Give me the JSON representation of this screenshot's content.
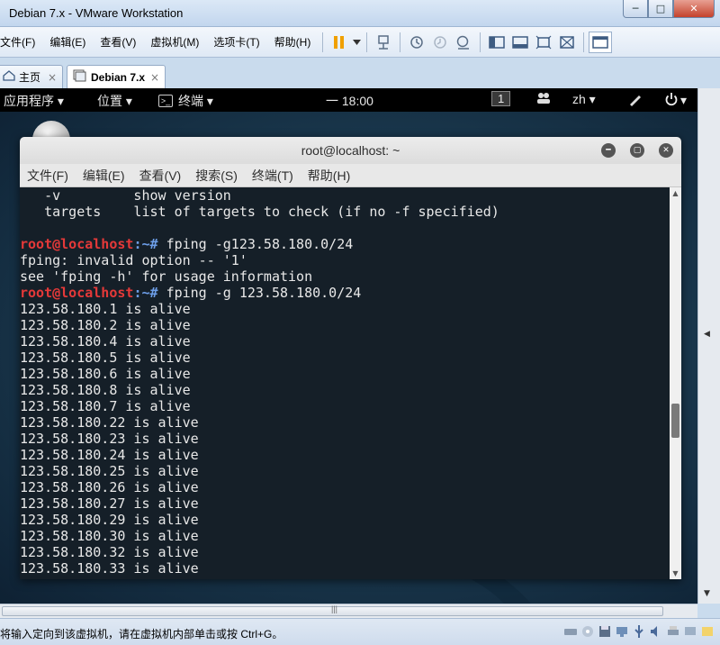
{
  "window": {
    "title": "Debian 7.x - VMware Workstation",
    "min": "─",
    "max": "□",
    "close": "✕"
  },
  "menu": [
    "文件(F)",
    "编辑(E)",
    "查看(V)",
    "虚拟机(M)",
    "选项卡(T)",
    "帮助(H)"
  ],
  "tabs": [
    {
      "label": "主页",
      "close": "×"
    },
    {
      "label": "Debian 7.x",
      "close": "×"
    }
  ],
  "gnome": {
    "apps": "应用程序 ▾",
    "places": "位置 ▾",
    "terminal": "终端 ▾",
    "clock": "一 18:00",
    "workspace": "1",
    "lang": "zh ▾",
    "power": "▾"
  },
  "terminal": {
    "title": "root@localhost: ~",
    "menu": [
      "文件(F)",
      "编辑(E)",
      "查看(V)",
      "搜索(S)",
      "终端(T)",
      "帮助(H)"
    ],
    "prompt_user": "root@localhost",
    "prompt_sep": ":~# ",
    "lines": [
      {
        "type": "text",
        "text": "   -v         show version"
      },
      {
        "type": "text",
        "text": "   targets    list of targets to check (if no -f specified)"
      },
      {
        "type": "text",
        "text": ""
      },
      {
        "type": "cmd",
        "cmd": "fping -g123.58.180.0/24"
      },
      {
        "type": "text",
        "text": "fping: invalid option -- '1'"
      },
      {
        "type": "text",
        "text": "see 'fping -h' for usage information"
      },
      {
        "type": "cmd",
        "cmd": "fping -g 123.58.180.0/24"
      },
      {
        "type": "text",
        "text": "123.58.180.1 is alive"
      },
      {
        "type": "text",
        "text": "123.58.180.2 is alive"
      },
      {
        "type": "text",
        "text": "123.58.180.4 is alive"
      },
      {
        "type": "text",
        "text": "123.58.180.5 is alive"
      },
      {
        "type": "text",
        "text": "123.58.180.6 is alive"
      },
      {
        "type": "text",
        "text": "123.58.180.8 is alive"
      },
      {
        "type": "text",
        "text": "123.58.180.7 is alive"
      },
      {
        "type": "text",
        "text": "123.58.180.22 is alive"
      },
      {
        "type": "text",
        "text": "123.58.180.23 is alive"
      },
      {
        "type": "text",
        "text": "123.58.180.24 is alive"
      },
      {
        "type": "text",
        "text": "123.58.180.25 is alive"
      },
      {
        "type": "text",
        "text": "123.58.180.26 is alive"
      },
      {
        "type": "text",
        "text": "123.58.180.27 is alive"
      },
      {
        "type": "text",
        "text": "123.58.180.29 is alive"
      },
      {
        "type": "text",
        "text": "123.58.180.30 is alive"
      },
      {
        "type": "text",
        "text": "123.58.180.32 is alive"
      },
      {
        "type": "text",
        "text": "123.58.180.33 is alive"
      }
    ]
  },
  "status": {
    "message": "将输入定向到该虚拟机，请在虚拟机内部单击或按 Ctrl+G。"
  },
  "colors": {
    "prompt_user": "#e53939",
    "prompt_path": "#6d9ee8",
    "pause": "#f0a000"
  }
}
